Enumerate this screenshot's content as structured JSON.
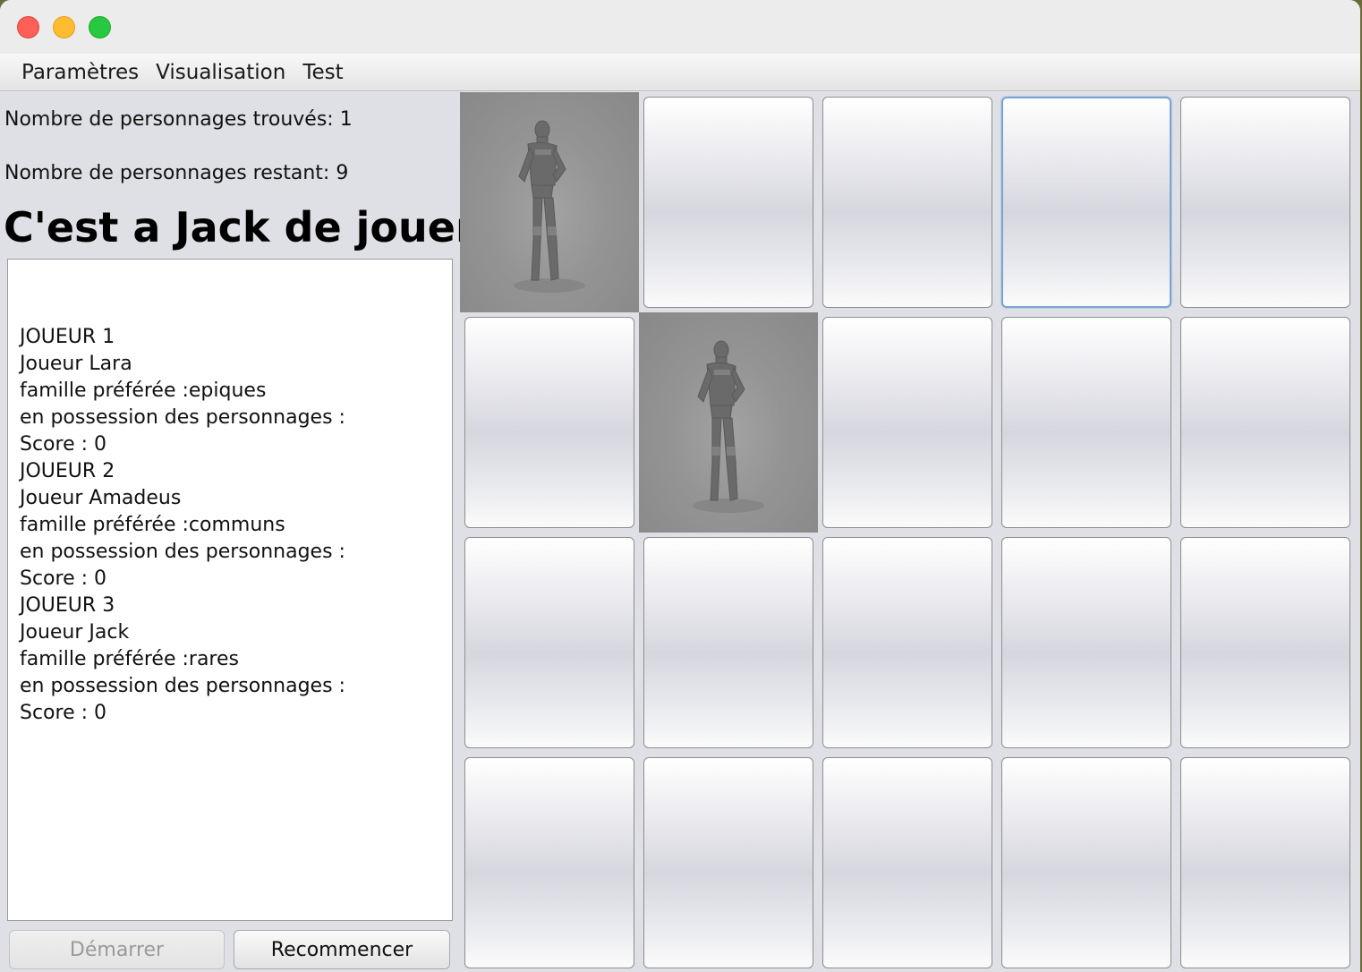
{
  "window": {
    "controls": [
      "close",
      "minimize",
      "zoom"
    ]
  },
  "menu": {
    "items": [
      "Paramètres",
      "Visualisation",
      "Test"
    ]
  },
  "stats": {
    "found": "Nombre de personnages trouvés: 1",
    "remaining": "Nombre de personnages restant: 9"
  },
  "turn_label": "C'est a Jack de jouer",
  "players_info": [
    "JOUEUR 1",
    "Joueur Lara",
    "famille préférée :epiques",
    "en possession des personnages :",
    "Score : 0",
    "JOUEUR 2",
    "Joueur Amadeus",
    "famille préférée :communs",
    "en possession des personnages :",
    "Score : 0",
    "JOUEUR 3",
    "Joueur Jack",
    "famille préférée :rares",
    "en possession des personnages :",
    "Score : 0"
  ],
  "buttons": {
    "start": "Démarrer",
    "restart": "Recommencer"
  },
  "board": {
    "rows": 4,
    "cols": 5,
    "revealed": [
      [
        0,
        0
      ],
      [
        1,
        1
      ]
    ],
    "focused": [
      0,
      3
    ],
    "revealed_icon": "character-figure-icon"
  }
}
